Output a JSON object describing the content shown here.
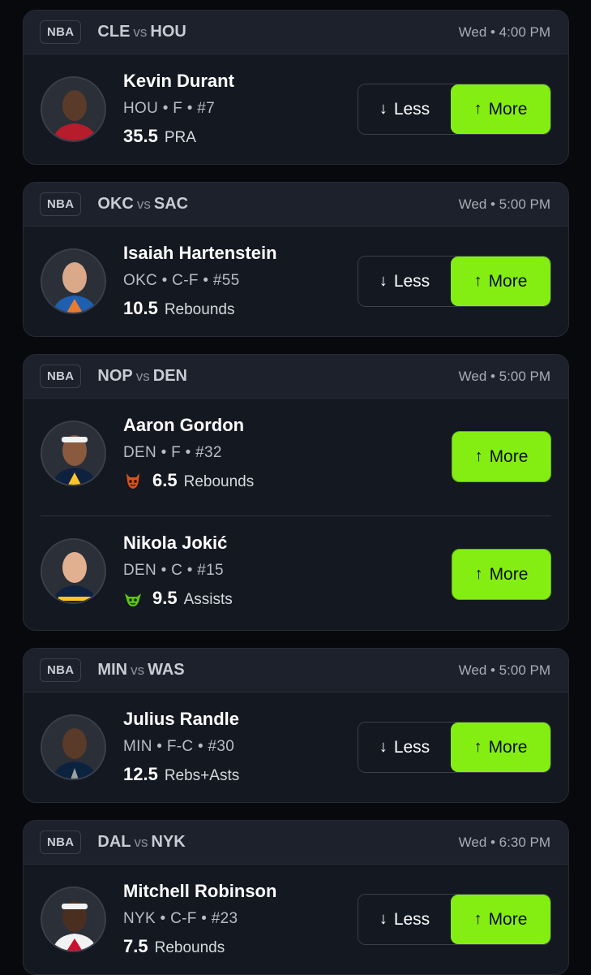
{
  "cards": [
    {
      "league": "NBA",
      "home": "CLE",
      "vs": "vs",
      "away": "HOU",
      "time": "Wed • 4:00 PM",
      "players": [
        {
          "name": "Kevin Durant",
          "info": "HOU • F • #7",
          "line": "35.5",
          "stat": "PRA",
          "less": "Less",
          "more": "More"
        }
      ]
    },
    {
      "league": "NBA",
      "home": "OKC",
      "vs": "vs",
      "away": "SAC",
      "time": "Wed • 5:00 PM",
      "players": [
        {
          "name": "Isaiah Hartenstein",
          "info": "OKC • C-F • #55",
          "line": "10.5",
          "stat": "Rebounds",
          "less": "Less",
          "more": "More"
        }
      ]
    },
    {
      "league": "NBA",
      "home": "NOP",
      "vs": "vs",
      "away": "DEN",
      "time": "Wed • 5:00 PM",
      "players": [
        {
          "name": "Aaron Gordon",
          "info": "DEN • F • #32",
          "line": "6.5",
          "stat": "Rebounds",
          "more": "More",
          "badge": "demon-icon"
        },
        {
          "name": "Nikola Jokić",
          "info": "DEN • C • #15",
          "line": "9.5",
          "stat": "Assists",
          "more": "More",
          "badge": "goblin-icon"
        }
      ]
    },
    {
      "league": "NBA",
      "home": "MIN",
      "vs": "vs",
      "away": "WAS",
      "time": "Wed • 5:00 PM",
      "players": [
        {
          "name": "Julius Randle",
          "info": "MIN • F-C • #30",
          "line": "12.5",
          "stat": "Rebs+Asts",
          "less": "Less",
          "more": "More"
        }
      ]
    },
    {
      "league": "NBA",
      "home": "DAL",
      "vs": "vs",
      "away": "NYK",
      "time": "Wed • 6:30 PM",
      "players": [
        {
          "name": "Mitchell Robinson",
          "info": "NYK • C-F • #23",
          "line": "7.5",
          "stat": "Rebounds",
          "less": "Less",
          "more": "More"
        }
      ]
    }
  ],
  "colors": {
    "accent": "#84ee12",
    "card": "#141821",
    "header": "#1d212b",
    "background": "#07090d"
  },
  "icons": {
    "less": "arrow-down-icon",
    "more": "arrow-up-icon"
  }
}
